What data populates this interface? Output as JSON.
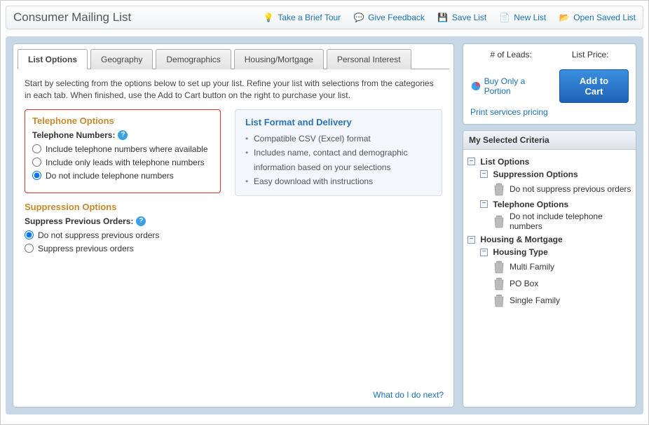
{
  "header": {
    "title": "Consumer Mailing List",
    "links": {
      "tour": "Take a Brief Tour",
      "feedback": "Give Feedback",
      "save": "Save List",
      "new": "New List",
      "open": "Open Saved List"
    }
  },
  "tabs": {
    "list_options": "List Options",
    "geography": "Geography",
    "demographics": "Demographics",
    "housing": "Housing/Mortgage",
    "personal": "Personal Interest"
  },
  "intro": "Start by selecting from the options below to set up your list. Refine your list with selections from the categories in each tab. When finished, use the Add to Cart button on the right to purchase your list.",
  "telephone": {
    "section_title": "Telephone Options",
    "label": "Telephone Numbers:",
    "opt1": "Include telephone numbers where available",
    "opt2": "Include only leads with telephone numbers",
    "opt3": "Do not include telephone numbers"
  },
  "suppression": {
    "section_title": "Suppression Options",
    "label": "Suppress Previous Orders:",
    "opt1": "Do not suppress previous orders",
    "opt2": "Suppress previous orders"
  },
  "info": {
    "title": "List Format and Delivery",
    "b1": "Compatible CSV (Excel) format",
    "b2": "Includes name, contact and demographic information based on your selections",
    "b3": "Easy download with instructions"
  },
  "next_link": "What do I do next?",
  "sidebar": {
    "leads_label": "# of Leads:",
    "price_label": "List Price:",
    "buy_portion": "Buy Only a Portion",
    "add_cart": "Add to Cart",
    "pricing": "Print services pricing",
    "criteria_head": "My Selected Criteria",
    "tree": {
      "list_options": "List Options",
      "suppression": "Suppression Options",
      "suppression_leaf": "Do not suppress previous orders",
      "telephone": "Telephone Options",
      "telephone_leaf": "Do not include telephone numbers",
      "housing": "Housing & Mortgage",
      "housing_type": "Housing Type",
      "ht1": "Multi Family",
      "ht2": "PO Box",
      "ht3": "Single Family"
    }
  }
}
